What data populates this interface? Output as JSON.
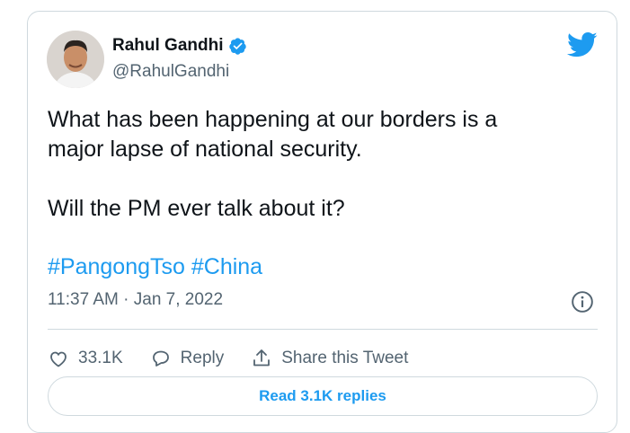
{
  "author": {
    "name": "Rahul Gandhi",
    "handle": "@RahulGandhi",
    "verified": true
  },
  "tweet": {
    "lines": [
      "What has been happening at our borders is a",
      "major lapse of national security."
    ],
    "question": "Will the PM ever talk about it?",
    "hashtags": [
      "#PangongTso",
      "#China"
    ],
    "timestamp": "11:37 AM · Jan 7, 2022"
  },
  "actions": {
    "likes": "33.1K",
    "reply_label": "Reply",
    "share_label": "Share this Tweet"
  },
  "replies_button": "Read 3.1K replies",
  "colors": {
    "accent": "#1d9bf0",
    "text": "#0f1419",
    "muted": "#536471",
    "border": "#cfd9de"
  }
}
